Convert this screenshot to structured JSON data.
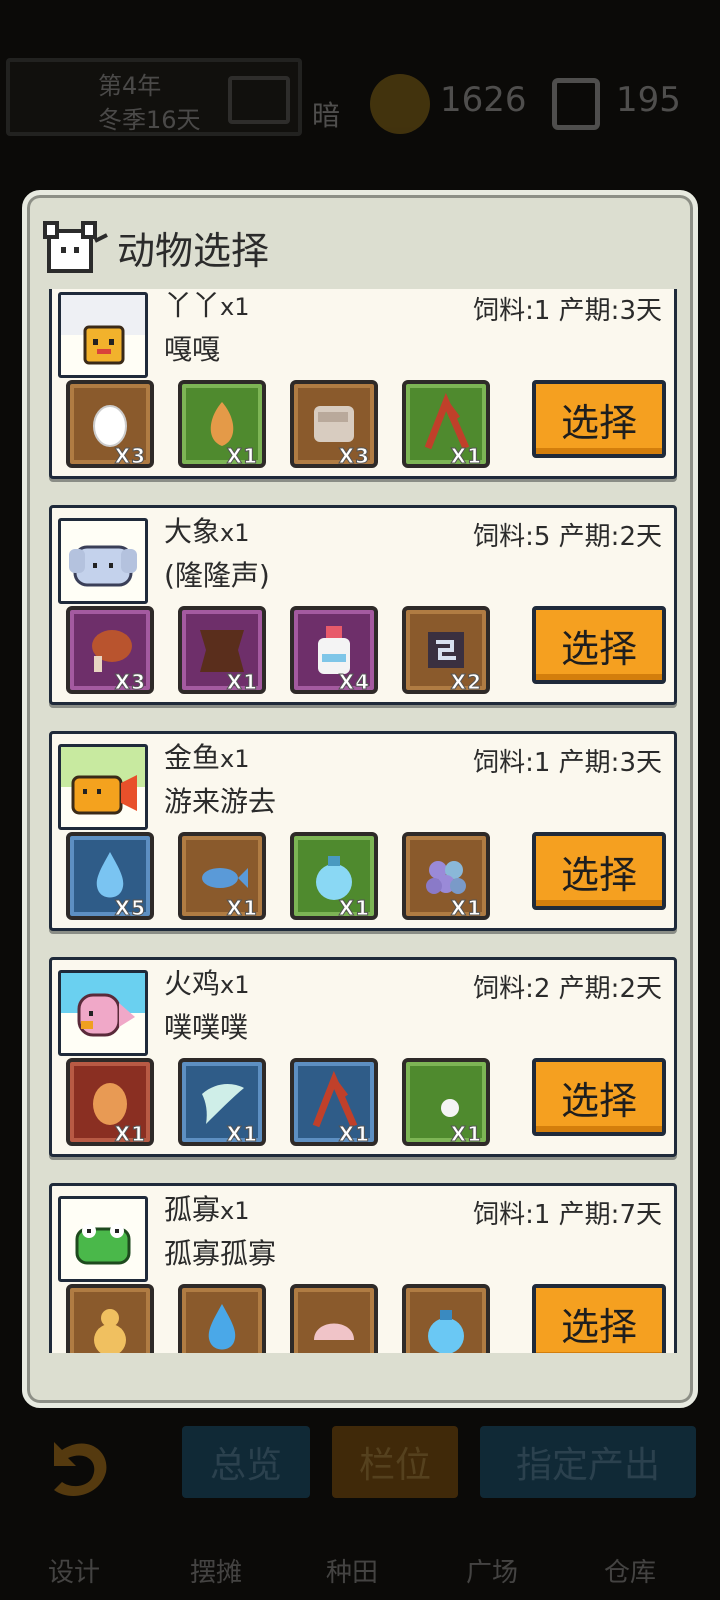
{
  "status_bar": {
    "date_line1": "第4年",
    "date_line2": "冬季16天",
    "weather": "暗",
    "gold": "1626",
    "tickets": "195"
  },
  "modal": {
    "title": "动物选择",
    "select_label": "选择",
    "feed_prefix": "饲料:",
    "period_prefix": "产期:",
    "period_unit": "天"
  },
  "animals": [
    {
      "name": "丫丫",
      "qty": "x1",
      "sound": "嘎嘎",
      "feed": "1",
      "period": "3",
      "portrait": "duck-icon",
      "items": [
        {
          "icon": "egg-icon",
          "count": "X3",
          "color": "brown"
        },
        {
          "icon": "seed-icon",
          "count": "X1",
          "color": "green"
        },
        {
          "icon": "cloth-icon",
          "count": "X3",
          "color": "brown"
        },
        {
          "icon": "branch-icon",
          "count": "X1",
          "color": "green"
        }
      ]
    },
    {
      "name": "大象",
      "qty": "x1",
      "sound": "(隆隆声)",
      "feed": "5",
      "period": "2",
      "portrait": "elephant-icon",
      "items": [
        {
          "icon": "meat-icon",
          "count": "X3",
          "color": "purple"
        },
        {
          "icon": "leather-icon",
          "count": "X1",
          "color": "purple"
        },
        {
          "icon": "milk-jar-icon",
          "count": "X4",
          "color": "purple"
        },
        {
          "icon": "rune-icon",
          "count": "X2",
          "color": "brown"
        }
      ]
    },
    {
      "name": "金鱼",
      "qty": "x1",
      "sound": "游来游去",
      "feed": "1",
      "period": "3",
      "portrait": "goldfish-icon",
      "items": [
        {
          "icon": "water-drop-icon",
          "count": "X5",
          "color": "blue"
        },
        {
          "icon": "fish-icon",
          "count": "X1",
          "color": "brown"
        },
        {
          "icon": "potion-icon",
          "count": "X1",
          "color": "green"
        },
        {
          "icon": "grape-icon",
          "count": "X1",
          "color": "brown"
        }
      ]
    },
    {
      "name": "火鸡",
      "qty": "x1",
      "sound": "噗噗噗",
      "feed": "2",
      "period": "2",
      "portrait": "turkey-icon",
      "items": [
        {
          "icon": "brown-egg-icon",
          "count": "X1",
          "color": "red"
        },
        {
          "icon": "feather-icon",
          "count": "X1",
          "color": "blue"
        },
        {
          "icon": "branch-icon",
          "count": "X1",
          "color": "blue"
        },
        {
          "icon": "pearl-icon",
          "count": "X1",
          "color": "green"
        }
      ]
    },
    {
      "name": "孤寡",
      "qty": "x1",
      "sound": "孤寡孤寡",
      "feed": "1",
      "period": "7",
      "portrait": "frog-icon",
      "items": [
        {
          "icon": "gourd-icon",
          "count": "",
          "color": "brown"
        },
        {
          "icon": "water-drop-icon",
          "count": "",
          "color": "brown"
        },
        {
          "icon": "shell-icon",
          "count": "",
          "color": "brown"
        },
        {
          "icon": "potion-icon",
          "count": "",
          "color": "brown"
        }
      ]
    }
  ],
  "bottom_tabs": {
    "overview": "总览",
    "slot": "栏位",
    "assign_output": "指定产出"
  },
  "bottom_nav": [
    "设计",
    "摆摊",
    "种田",
    "广场",
    "仓库"
  ]
}
